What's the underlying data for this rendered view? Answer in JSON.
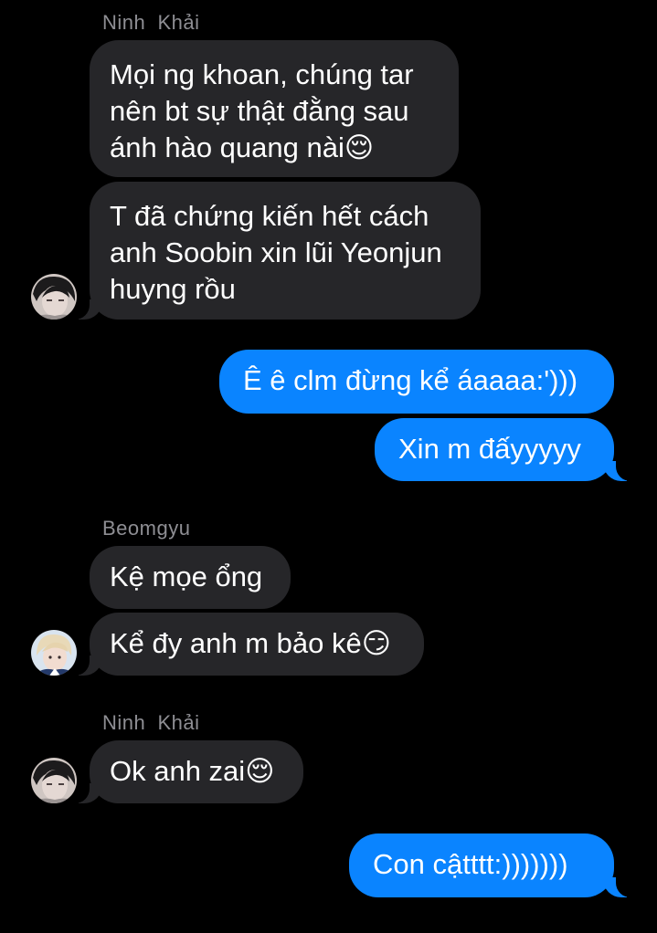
{
  "groups": [
    {
      "sender": "Ninh  Khải",
      "avatar_icon": "person-avatar-dark-hair",
      "messages": [
        "Mọi ng khoan, chúng tar\nnên bt sự thật đằng sau\nánh hào quang nài😌",
        "T đã chứng kiến hết cách\nanh Soobin xin lũi Yeonjun\nhuyng rồu"
      ]
    },
    {
      "sender": "Beomgyu",
      "avatar_icon": "person-avatar-light-hair",
      "messages": [
        "Kệ mọe ổng",
        "Kể đy anh m bảo kê😏"
      ]
    },
    {
      "sender": "Ninh  Khải",
      "avatar_icon": "person-avatar-dark-hair",
      "messages": [
        "Ok anh zai😌"
      ]
    }
  ],
  "outgoing": [
    "Ê ê clm đừng kể áaaaa:')))",
    "Xin m đấyyyyy",
    "Con cậtttt:)))))))"
  ],
  "colors": {
    "incoming_bubble": "#262629",
    "outgoing_bubble": "#0a84ff",
    "background": "#000000"
  }
}
